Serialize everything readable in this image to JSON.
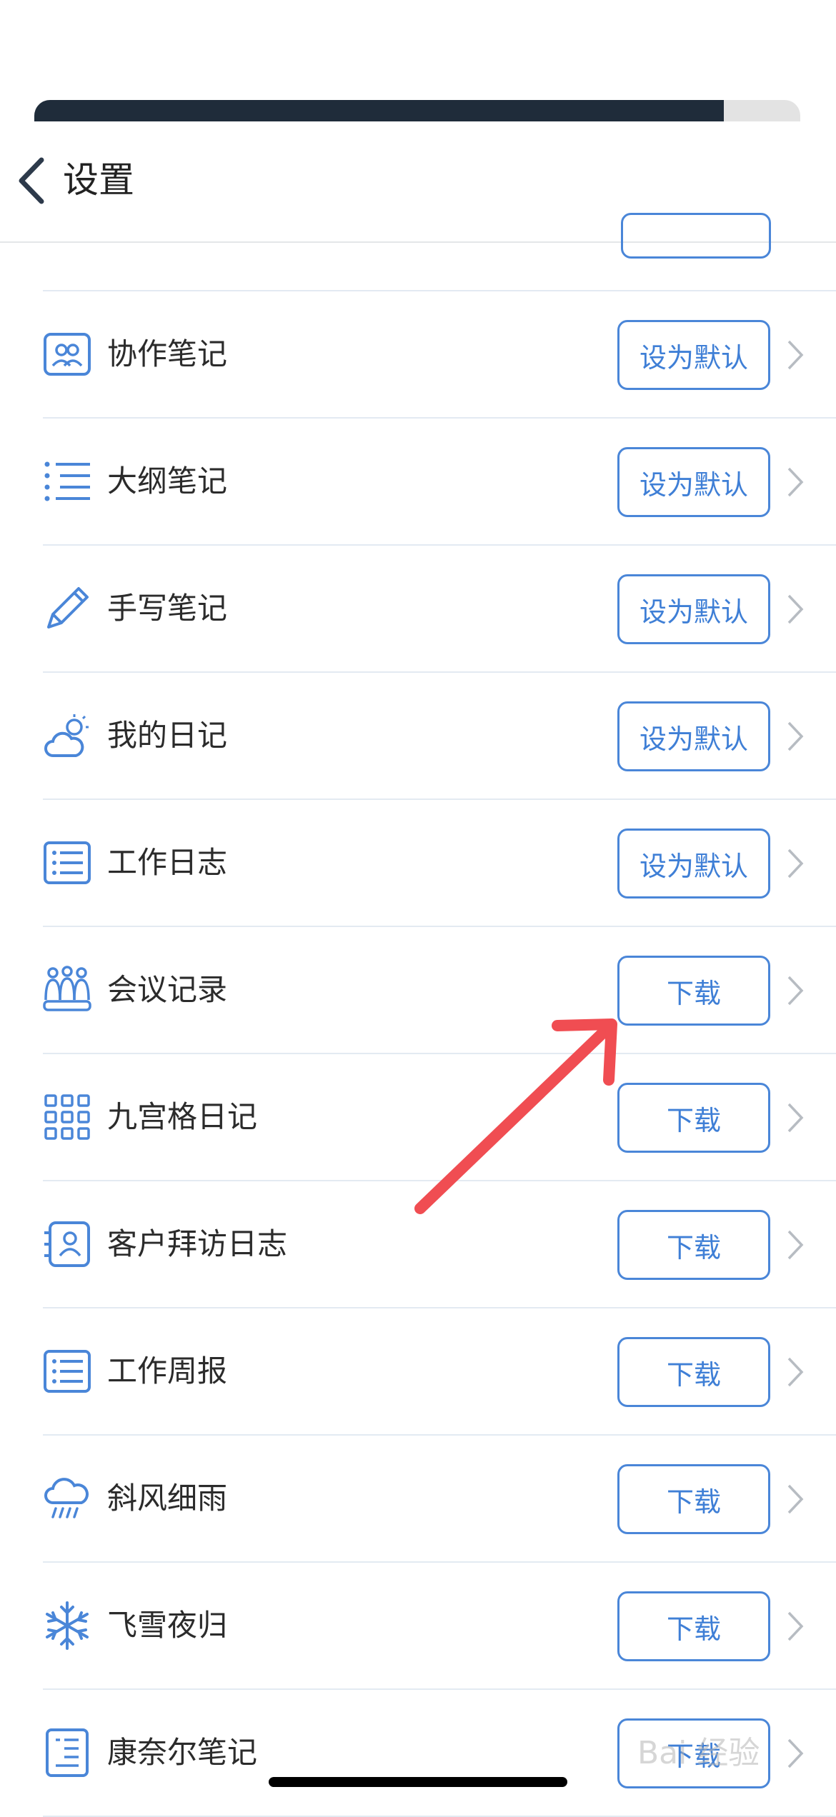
{
  "progress": 0.9,
  "header": {
    "back_icon": "chevron-left-icon",
    "title": "设置"
  },
  "rows": [
    {
      "label": "协作笔记",
      "button": "设为默认",
      "icon": "collaboration-icon"
    },
    {
      "label": "大纲笔记",
      "button": "设为默认",
      "icon": "outline-list-icon"
    },
    {
      "label": "手写笔记",
      "button": "设为默认",
      "icon": "pen-icon"
    },
    {
      "label": "我的日记",
      "button": "设为默认",
      "icon": "weather-cloud-sun-icon"
    },
    {
      "label": "工作日志",
      "button": "设为默认",
      "icon": "work-log-list-icon"
    },
    {
      "label": "会议记录",
      "button": "下载",
      "icon": "meeting-people-icon"
    },
    {
      "label": "九宫格日记",
      "button": "下载",
      "icon": "nine-grid-icon"
    },
    {
      "label": "客户拜访日志",
      "button": "下载",
      "icon": "customer-contact-icon"
    },
    {
      "label": "工作周报",
      "button": "下载",
      "icon": "weekly-report-list-icon"
    },
    {
      "label": "斜风细雨",
      "button": "下载",
      "icon": "rain-cloud-icon"
    },
    {
      "label": "飞雪夜归",
      "button": "下载",
      "icon": "snowflake-icon"
    },
    {
      "label": "康奈尔笔记",
      "button": "下载",
      "icon": "cornell-notes-icon"
    }
  ],
  "colors": {
    "accent": "#4a86d8",
    "arrow": "#f04d52",
    "progress": "#1f2c3a"
  },
  "watermark": "Bai 经验"
}
